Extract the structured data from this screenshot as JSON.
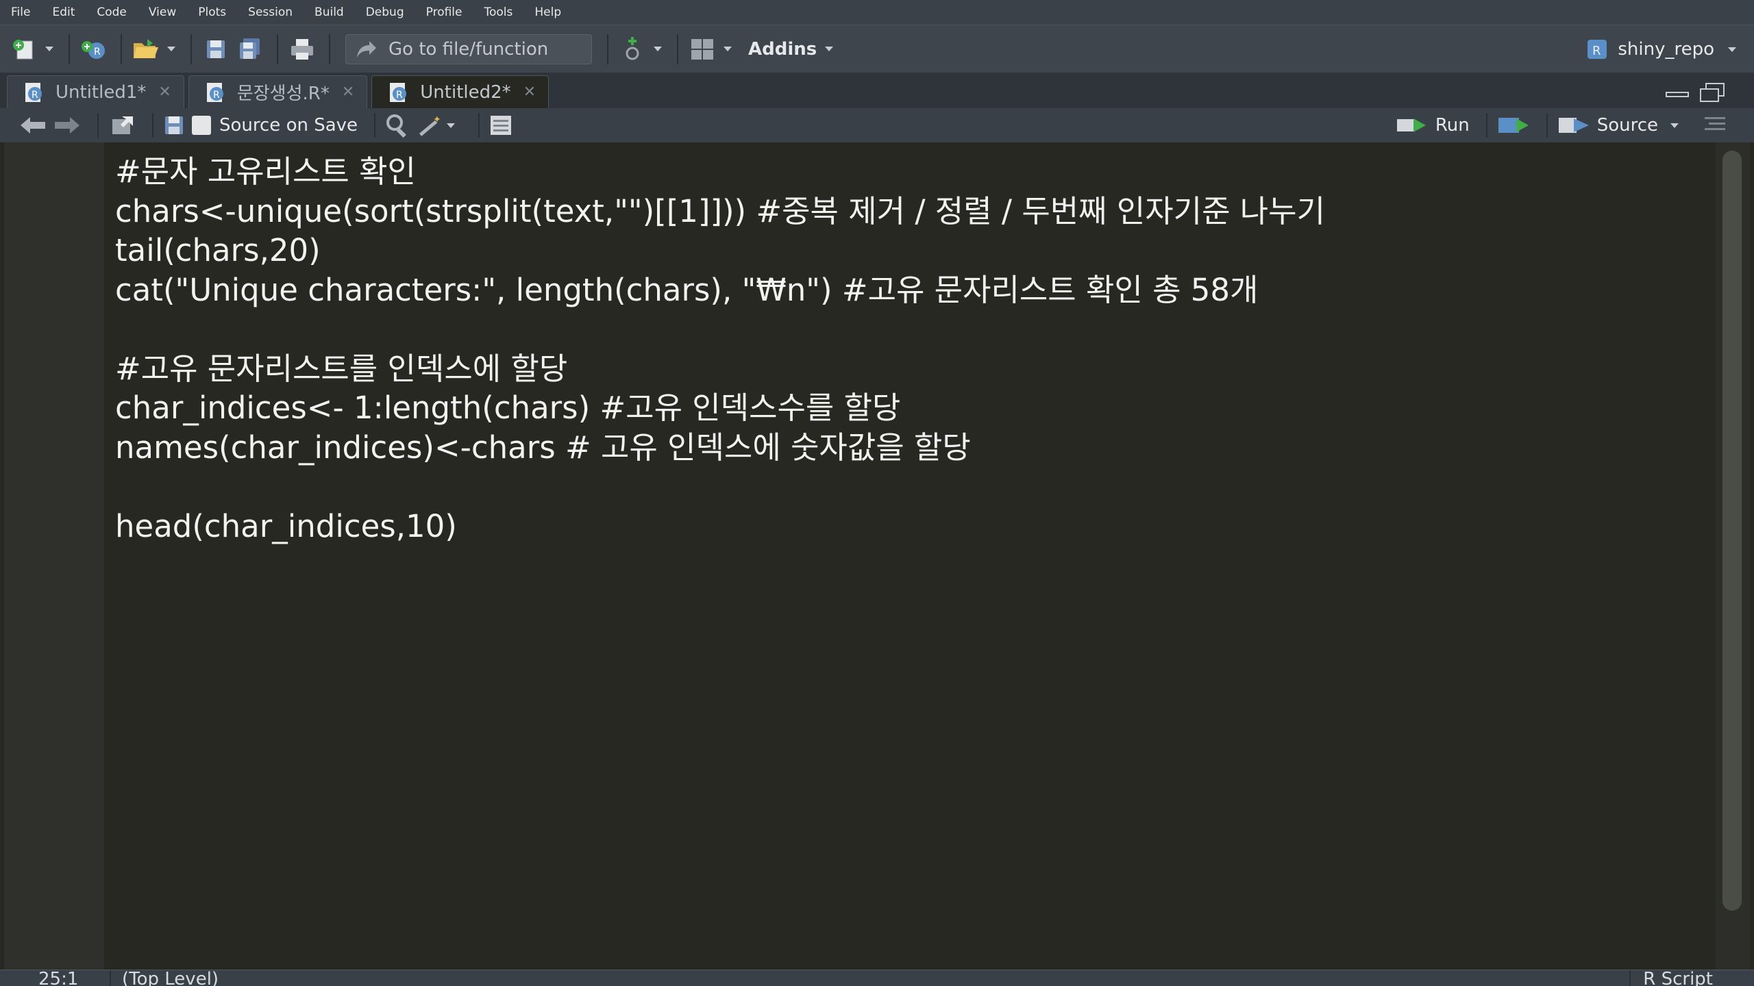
{
  "menu": [
    "File",
    "Edit",
    "Code",
    "View",
    "Plots",
    "Session",
    "Build",
    "Debug",
    "Profile",
    "Tools",
    "Help"
  ],
  "toolbar": {
    "goto_placeholder": "Go to file/function",
    "addins_label": "Addins",
    "project_name": "shiny_repo"
  },
  "tabs": [
    {
      "label": "Untitled1*",
      "active": false
    },
    {
      "label": "문장생성.R*",
      "active": false
    },
    {
      "label": "Untitled2*",
      "active": true
    }
  ],
  "editor_toolbar": {
    "source_on_save_label": "Source on Save",
    "run_label": "Run",
    "source_label": "Source"
  },
  "code_lines": [
    "#문자 고유리스트 확인",
    "chars<-unique(sort(strsplit(text,\"\")[[1]])) #중복 제거 / 정렬 / 두번째 인자기준 나누기",
    "tail(chars,20)",
    "cat(\"Unique characters:\", length(chars), \"₩n\") #고유 문자리스트 확인 총 58개",
    "",
    "#고유 문자리스트를 인덱스에 할당",
    "char_indices<- 1:length(chars) #고유 인덱스수를 할당",
    "names(char_indices)<-chars # 고유 인덱스에 숫자값을 할당",
    "",
    "head(char_indices,10)"
  ],
  "status": {
    "cursor_position": "25:1",
    "scope": "(Top Level)",
    "file_type": "R Script"
  },
  "icons": {
    "new_file": "new-file-icon",
    "open": "open-folder-icon",
    "save": "save-icon",
    "print": "print-icon",
    "run": "run-icon",
    "source": "source-icon"
  },
  "colors": {
    "editor_bg": "#272822",
    "toolbar_bg": "#3e454d",
    "text": "#f2f2ef"
  }
}
